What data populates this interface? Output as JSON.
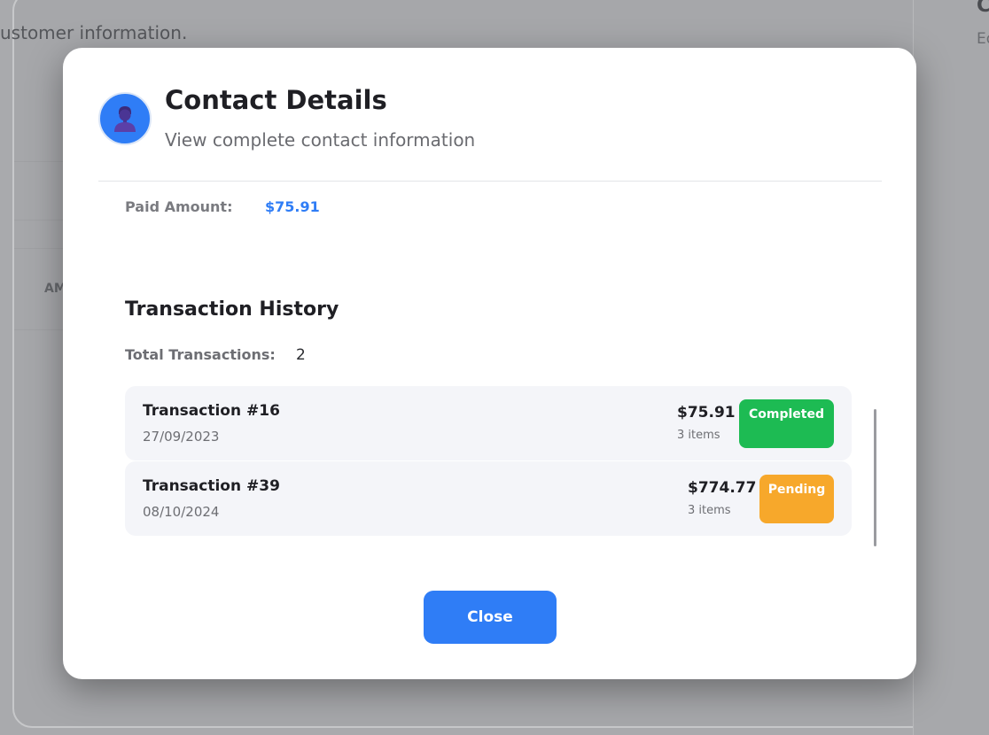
{
  "background": {
    "subtitle_text": "ustomer information.",
    "column_header_partial": "AM",
    "right_title_partial": "C",
    "right_sub_partial": "Ed"
  },
  "modal": {
    "title": "Contact Details",
    "subtitle": "View complete contact information",
    "avatar_icon": "user-icon",
    "paid_amount": {
      "label": "Paid Amount:",
      "value": "$75.91"
    },
    "transactions": {
      "section_title": "Transaction History",
      "total_label": "Total Transactions:",
      "total_value": "2",
      "items": [
        {
          "name": "Transaction #16",
          "date": "27/09/2023",
          "amount": "$75.91",
          "items": "3 items",
          "status": "Completed",
          "status_color": "#1dbb53"
        },
        {
          "name": "Transaction #39",
          "date": "08/10/2024",
          "amount": "$774.77",
          "items": "3 items",
          "status": "Pending",
          "status_color": "#f7a82b"
        }
      ]
    },
    "close_label": "Close"
  },
  "colors": {
    "accent": "#2f7df6",
    "success": "#1dbb53",
    "warning": "#f7a82b"
  }
}
